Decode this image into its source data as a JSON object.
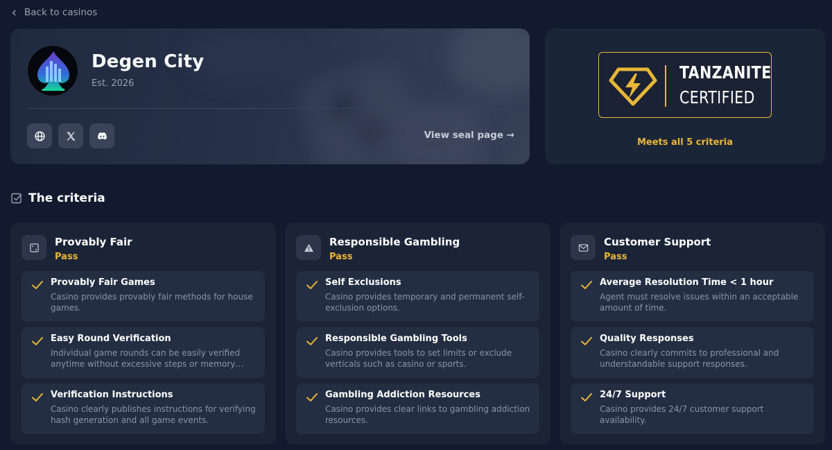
{
  "nav": {
    "back_label": "Back to casinos"
  },
  "casino": {
    "name": "Degen City",
    "established": "Est. 2026",
    "seal_link": "View seal page →",
    "socials": [
      {
        "icon": "globe-icon"
      },
      {
        "icon": "x-icon"
      },
      {
        "icon": "discord-icon"
      }
    ]
  },
  "certification": {
    "badge_line1": "TANZANITE",
    "badge_line2": "CERTIFIED",
    "summary": "Meets all 5 criteria",
    "accent": "#e8b738"
  },
  "criteria": {
    "heading": "The criteria",
    "categories": [
      {
        "title": "Provably Fair",
        "status": "Pass",
        "icon": "dice-icon",
        "items": [
          {
            "title": "Provably Fair Games",
            "desc": "Casino provides provably fair methods for house games."
          },
          {
            "title": "Easy Round Verification",
            "desc": "Individual game rounds can be easily verified anytime without excessive steps or memory requirements."
          },
          {
            "title": "Verification Instructions",
            "desc": "Casino clearly publishes instructions for verifying hash generation and all game events."
          }
        ]
      },
      {
        "title": "Responsible Gambling",
        "status": "Pass",
        "icon": "warning-icon",
        "items": [
          {
            "title": "Self Exclusions",
            "desc": "Casino provides temporary and permanent self-exclusion options."
          },
          {
            "title": "Responsible Gambling Tools",
            "desc": "Casino provides tools to set limits or exclude verticals such as casino or sports."
          },
          {
            "title": "Gambling Addiction Resources",
            "desc": "Casino provides clear links to gambling addiction resources."
          }
        ]
      },
      {
        "title": "Customer Support",
        "status": "Pass",
        "icon": "mail-icon",
        "items": [
          {
            "title": "Average Resolution Time < 1 hour",
            "desc": "Agent must resolve issues within an acceptable amount of time."
          },
          {
            "title": "Quality Responses",
            "desc": "Casino clearly commits to professional and understandable support responses."
          },
          {
            "title": "24/7 Support",
            "desc": "Casino provides 24/7 customer support availability."
          }
        ]
      }
    ]
  }
}
